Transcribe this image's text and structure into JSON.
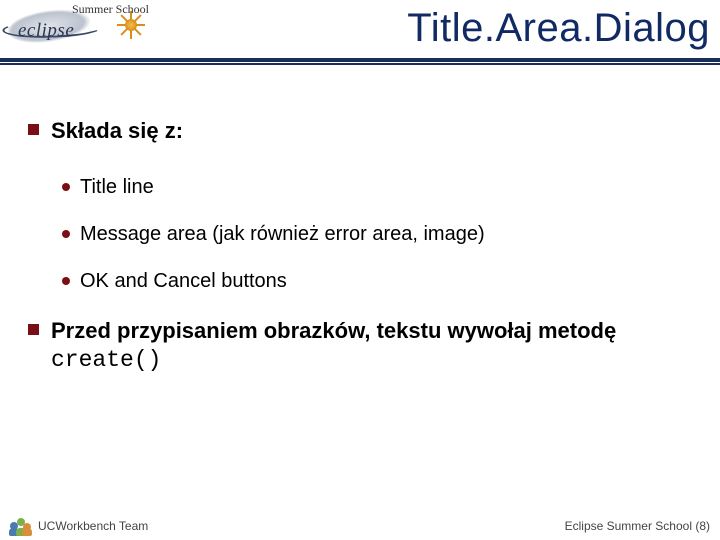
{
  "header": {
    "logo_text": "eclipse",
    "summer": "Summer School",
    "title": "Title.Area.Dialog"
  },
  "content": {
    "b1": {
      "intro": "Składa się z:"
    },
    "b1_sub": {
      "s1": "Title line",
      "s2": "Message area (jak również error area, image)",
      "s3": "OK and Cancel buttons"
    },
    "b2": {
      "text_a": "Przed przypisaniem obrazków, tekstu wywołaj metodę ",
      "code": "create()"
    }
  },
  "footer": {
    "left": "UCWorkbench Team",
    "right": "Eclipse Summer School (8)"
  }
}
